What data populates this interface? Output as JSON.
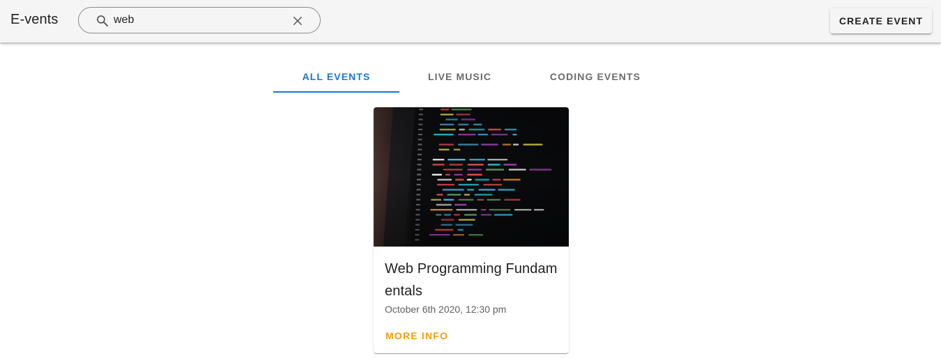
{
  "app": {
    "title": "E-vents"
  },
  "search": {
    "value": "web",
    "icon": "search-icon",
    "clear_icon": "close-icon"
  },
  "toolbar": {
    "create_label": "CREATE EVENT"
  },
  "tabs": [
    {
      "label": "ALL EVENTS",
      "active": true
    },
    {
      "label": "LIVE MUSIC",
      "active": false
    },
    {
      "label": "CODING EVENTS",
      "active": false
    }
  ],
  "events": [
    {
      "title": "Web Programming Fundamentals",
      "date": "October 6th 2020, 12:30 pm",
      "action_label": "MORE INFO"
    }
  ],
  "colors": {
    "primary": "#1976d2",
    "accent": "#f59e0b",
    "appbar": "#f5f5f5"
  }
}
